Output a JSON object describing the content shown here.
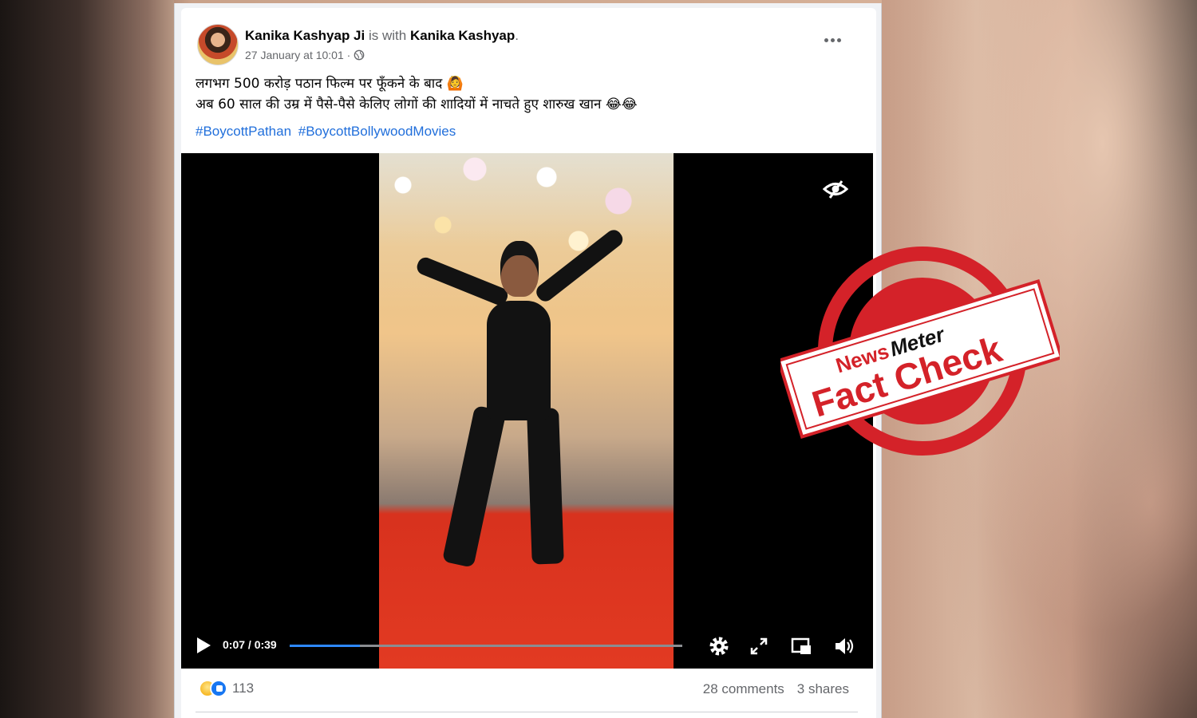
{
  "post": {
    "author": "Kanika Kashyap Ji",
    "with_text": " is with ",
    "tagged": "Kanika Kashyap",
    "tagged_suffix": ".",
    "timestamp": "27 January at 10:01 ·",
    "text_line1": "लगभग 500 करोड़ पठान फिल्म पर फूँकने के बाद 🙆",
    "text_line2": "अब 60 साल की उम्र में पैसे-पैसे केलिए लोगों की शादियों में नाचते हुए शारुख खान 😂😂",
    "hashtags": [
      "#BoycottPathan",
      "#BoycottBollywoodMovies"
    ]
  },
  "video": {
    "time_display": "0:07 / 0:39",
    "progress_fraction": 0.179
  },
  "footer": {
    "reaction_count": "113",
    "comments": "28 comments",
    "shares": "3 shares"
  },
  "stamp": {
    "brand_news": "News",
    "brand_meter": "Meter",
    "label": "Fact Check"
  },
  "colors": {
    "link": "#216fdb",
    "progress": "#2d88ff",
    "stamp_red": "#d42229"
  },
  "icons": [
    "globe-icon",
    "more-icon",
    "eye-slash-icon",
    "play-icon",
    "settings-icon",
    "fullscreen-icon",
    "pip-icon",
    "volume-icon"
  ]
}
